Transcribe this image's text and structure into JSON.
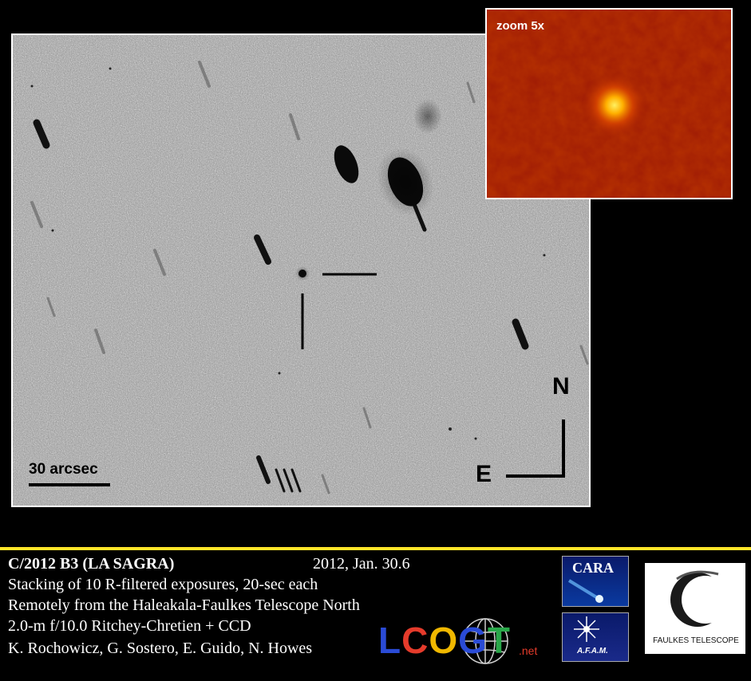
{
  "image": {
    "scale_label": "30 arcsec",
    "north_label": "N",
    "east_label": "E",
    "inset_label": "zoom 5x"
  },
  "caption": {
    "object": "C/2012 B3 (LA SAGRA)",
    "date": "2012, Jan. 30.6",
    "line2": "Stacking of 10 R-filtered exposures, 20-sec each",
    "line3": "Remotely from the Haleakala-Faulkes Telescope North",
    "line4": "2.0-m f/10.0 Ritchey-Chretien + CCD",
    "line5": "K. Rochowicz, G. Sostero, E. Guido, N. Howes"
  },
  "logos": {
    "lcogt_main": "LCOGT",
    "lcogt_suffix": ".net",
    "cara": "CARA",
    "afam": "A.F.A.M.",
    "faulkes": "FAULKES TELESCOPE"
  },
  "colors": {
    "rule": "#ffe62a",
    "inset_core": "#fff060",
    "inset_background": "#9c1a05"
  }
}
